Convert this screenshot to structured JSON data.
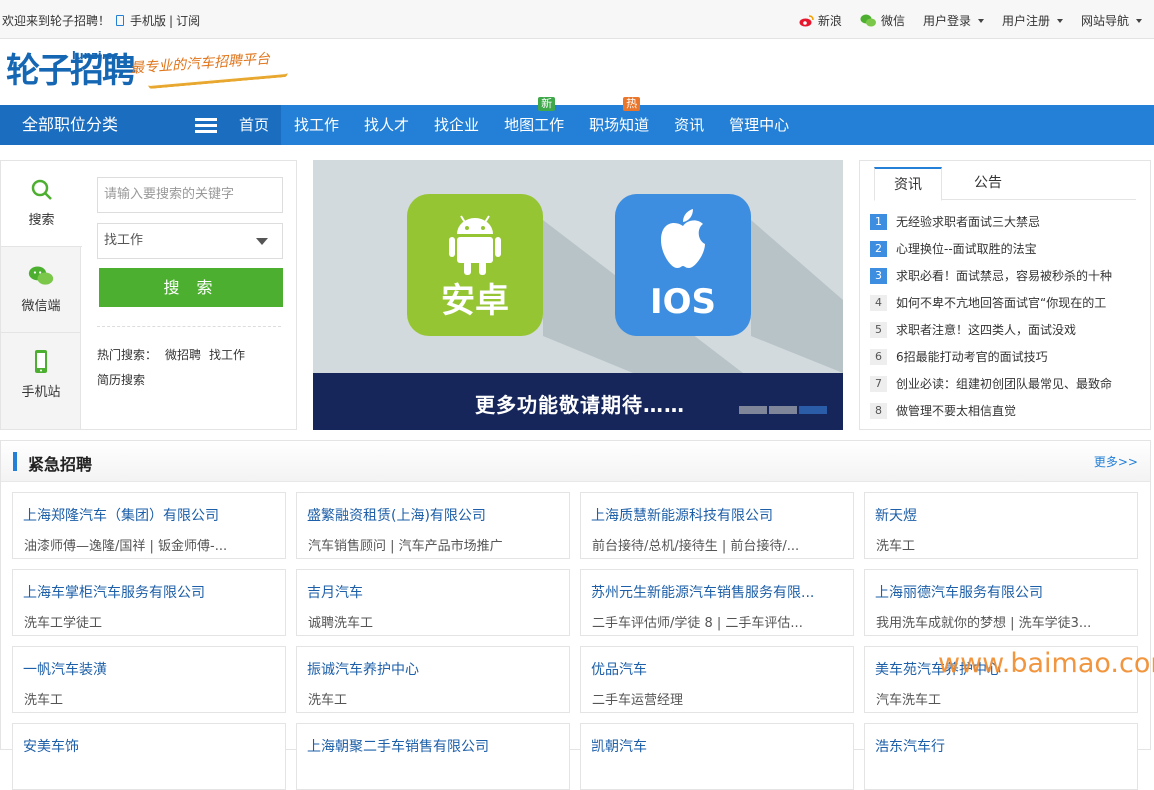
{
  "topbar": {
    "welcome": "欢迎来到轮子招聘！",
    "mobile": "手机版",
    "sep": "|",
    "subscribe": "订阅",
    "weibo": "新浪",
    "wechat": "微信",
    "login": "用户登录",
    "register": "用户注册",
    "sitenav": "网站导航"
  },
  "header": {
    "logo": "轮子招聘",
    "logo_domain": "lunzi.cc",
    "slogan": "最专业的汽车招聘平台"
  },
  "nav": {
    "category": "全部职位分类",
    "items": [
      {
        "label": "首页"
      },
      {
        "label": "找工作"
      },
      {
        "label": "找人才"
      },
      {
        "label": "找企业"
      },
      {
        "label": "地图工作",
        "badge": "新"
      },
      {
        "label": "职场知道",
        "badge": "热"
      },
      {
        "label": "资讯"
      },
      {
        "label": "管理中心"
      }
    ]
  },
  "search": {
    "tabs": [
      "搜索",
      "微信端",
      "手机站"
    ],
    "placeholder": "请输入要搜索的关键字",
    "select_value": "找工作",
    "button": "搜 索",
    "hot_label": "热门搜索：",
    "hot": [
      "微招聘",
      "找工作",
      "简历搜索"
    ]
  },
  "banner": {
    "android": "安卓",
    "ios": "IOS",
    "caption": "更多功能敬请期待……"
  },
  "news": {
    "tabs": [
      "资讯",
      "公告"
    ],
    "items": [
      "无经验求职者面试三大禁忌",
      "心理换位--面试取胜的法宝",
      "求职必看！面试禁忌，容易被秒杀的十种",
      "如何不卑不亢地回答面试官“你现在的工",
      "求职者注意！这四类人，面试没戏",
      "6招最能打动考官的面试技巧",
      "创业必读：组建初创团队最常见、最致命",
      "做管理不要太相信直觉"
    ]
  },
  "urgent": {
    "title": "紧急招聘",
    "more": "更多>>",
    "cards": [
      {
        "company": "上海郑隆汽车（集团）有限公司",
        "jobs": "油漆师傅—逸隆/国祥 | 钣金师傅-..."
      },
      {
        "company": "盛繁融资租赁(上海)有限公司",
        "jobs": "汽车销售顾问 | 汽车产品市场推广"
      },
      {
        "company": "上海质慧新能源科技有限公司",
        "jobs": "前台接待/总机/接待生 | 前台接待/..."
      },
      {
        "company": "新天煜",
        "jobs": "洗车工"
      },
      {
        "company": "上海车掌柜汽车服务有限公司",
        "jobs": "洗车工学徒工"
      },
      {
        "company": "吉月汽车",
        "jobs": "诚聘洗车工"
      },
      {
        "company": "苏州元生新能源汽车销售服务有限...",
        "jobs": "二手车评估师/学徒 8 | 二手车评估..."
      },
      {
        "company": "上海丽德汽车服务有限公司",
        "jobs": "我用洗车成就你的梦想 | 洗车学徒3..."
      },
      {
        "company": "一帆汽车装潢",
        "jobs": "洗车工"
      },
      {
        "company": "振诚汽车养护中心",
        "jobs": "洗车工"
      },
      {
        "company": "优品汽车",
        "jobs": "二手车运营经理"
      },
      {
        "company": "美车苑汽车养护中心",
        "jobs": "汽车洗车工"
      },
      {
        "company": "安美车饰",
        "jobs": ""
      },
      {
        "company": "上海朝聚二手车销售有限公司",
        "jobs": ""
      },
      {
        "company": "凯朝汽车",
        "jobs": ""
      },
      {
        "company": "浩东汽车行",
        "jobs": ""
      }
    ]
  },
  "watermark": "www.baimao.com",
  "colors": {
    "primary": "#2480d6",
    "nav_dark": "#1b6dc0",
    "search_green": "#4daf2f",
    "badge_new": "#3ea84a",
    "badge_hot": "#e9762a"
  }
}
